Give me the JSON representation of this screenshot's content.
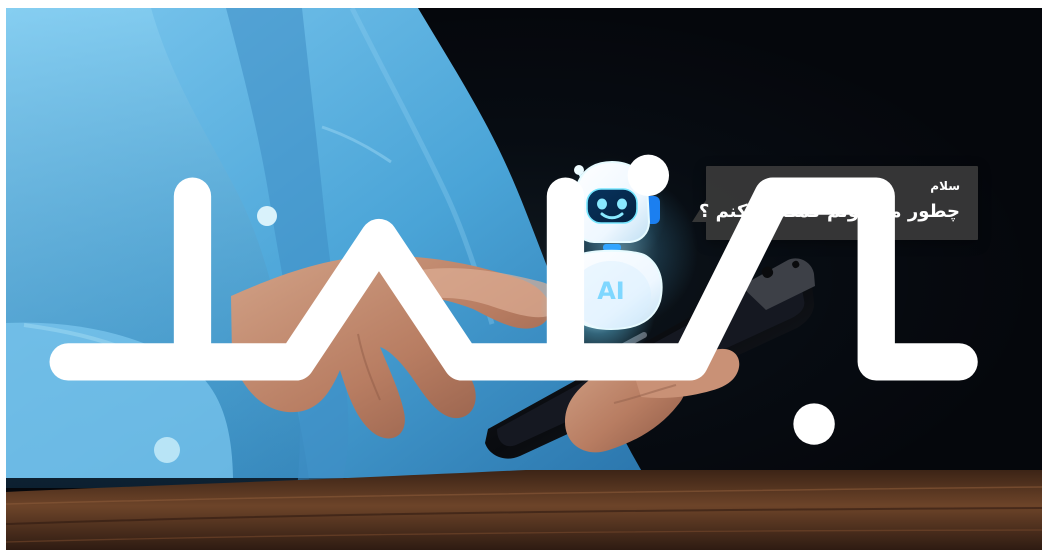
{
  "image": {
    "alt_text": "",
    "background_color": "#05070c",
    "shirt_color": "#5ab0df",
    "desk_color": "#5b3823",
    "robot_glow_color": "#7fdcff"
  },
  "chat_bubble": {
    "title": "سلام",
    "message": "چطور می تونم کمکتون کنم ؟"
  },
  "robot": {
    "chest_label": "AI"
  },
  "watermark": {
    "mark": "logo"
  }
}
